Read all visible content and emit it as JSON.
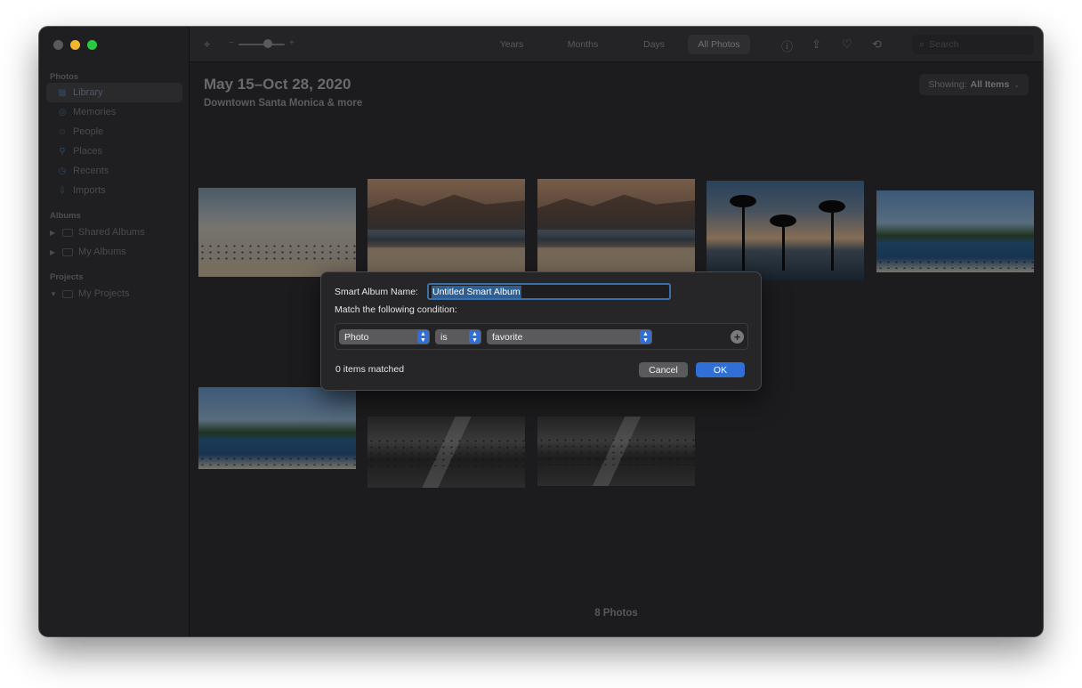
{
  "sidebar": {
    "sections": [
      {
        "title": "Photos"
      },
      {
        "title": "Albums"
      },
      {
        "title": "Projects"
      }
    ],
    "items": [
      {
        "label": "Library",
        "icon": "library-icon",
        "active": true
      },
      {
        "label": "Memories",
        "icon": "memories-icon"
      },
      {
        "label": "People",
        "icon": "people-icon"
      },
      {
        "label": "Places",
        "icon": "places-icon"
      },
      {
        "label": "Recents",
        "icon": "recents-icon"
      },
      {
        "label": "Imports",
        "icon": "imports-icon"
      },
      {
        "label": "Shared Albums",
        "icon": "folder-icon"
      },
      {
        "label": "My Albums",
        "icon": "folder-icon"
      },
      {
        "label": "My Projects",
        "icon": "folder-icon"
      }
    ]
  },
  "toolbar": {
    "zoom_minus": "−",
    "zoom_plus": "+",
    "segments": [
      {
        "label": "Years"
      },
      {
        "label": "Months"
      },
      {
        "label": "Days"
      },
      {
        "label": "All Photos",
        "active": true
      }
    ],
    "search_placeholder": "Search"
  },
  "content": {
    "date_range": "May 15–Oct 28, 2020",
    "location": "Downtown Santa Monica & more",
    "showing_label": "Showing:",
    "showing_value": "All Items",
    "photo_count": "8 Photos"
  },
  "dialog": {
    "name_label": "Smart Album Name:",
    "name_value": "Untitled Smart Album",
    "match_label": "Match the following condition:",
    "condition": {
      "field": "Photo",
      "operator": "is",
      "value": "favorite"
    },
    "matched_text": "0 items matched",
    "cancel_label": "Cancel",
    "ok_label": "OK"
  },
  "colors": {
    "accent_blue": "#2f6fd6",
    "traffic_yellow": "#f5b52a",
    "traffic_green": "#2bc93f"
  }
}
